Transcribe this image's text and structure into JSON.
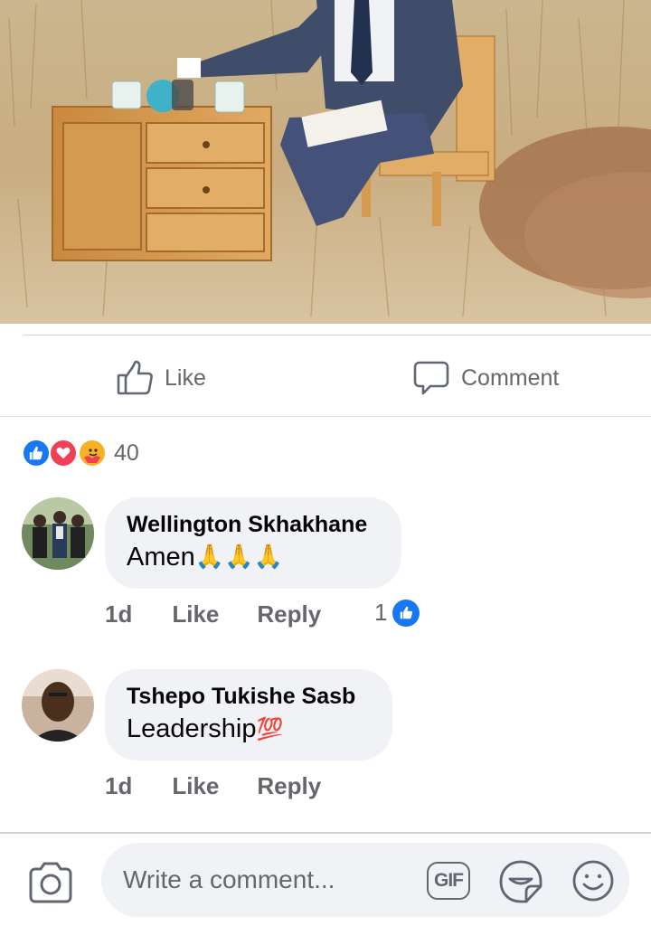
{
  "actions": {
    "like_label": "Like",
    "comment_label": "Comment"
  },
  "reactions": {
    "count": "40",
    "types": [
      "like-icon",
      "love-icon",
      "care-icon"
    ]
  },
  "comments": [
    {
      "author": "Wellington Skhakhane",
      "text": "Amen ",
      "emoji": "🙏🙏🙏",
      "time": "1d",
      "like_label": "Like",
      "reply_label": "Reply",
      "reaction_count": "1"
    },
    {
      "author": "Tshepo Tukishe Sasb",
      "text": "Leadership",
      "emoji": "💯",
      "time": "1d",
      "like_label": "Like",
      "reply_label": "Reply"
    }
  ],
  "composer": {
    "placeholder": "Write a comment...",
    "gif_label": "GIF"
  },
  "colors": {
    "accent": "#1877f2",
    "love": "#f33e58",
    "care": "#f7b125",
    "muted_text": "#65676b",
    "bubble_bg": "#f0f2f5"
  }
}
